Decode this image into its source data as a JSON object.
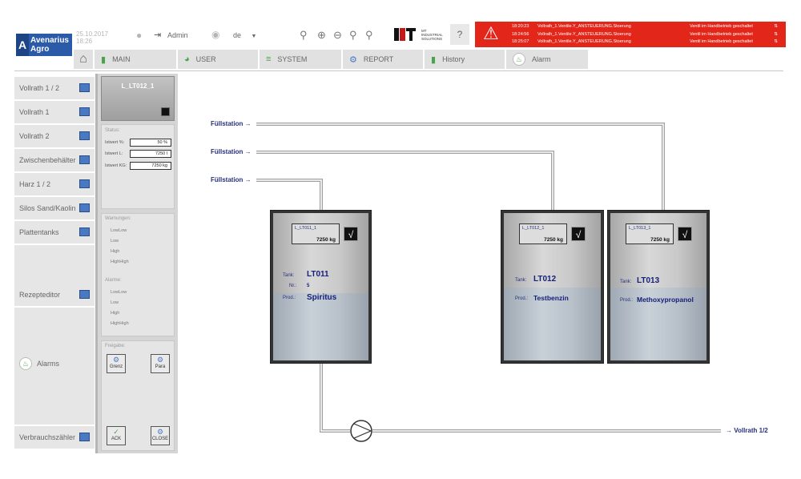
{
  "header": {
    "logo_line1": "Avenarius",
    "logo_line2": "Agro",
    "date": "25.10.2017",
    "time": "18:26",
    "user": "Admin",
    "language": "de",
    "help": "?",
    "brand_mark": "MT",
    "brand_line1": "MT",
    "brand_line2": "INDUSTRIAL",
    "brand_line3": "SOLUTIONS"
  },
  "alarms": [
    {
      "time": "18:20:23",
      "message": "Vollrath_1.Ventile.Y_ANSTEUERUNG.Stoerung",
      "state": "Ventil im Handbetrieb geschaltet"
    },
    {
      "time": "18:24:56",
      "message": "Vollrath_1.Ventile.Y_ANSTEUERUNG.Stoerung",
      "state": "Ventil im Handbetrieb geschaltet"
    },
    {
      "time": "18:25:07",
      "message": "Vollrath_1.Ventile.Y_ANSTEUERUNG.Stoerung",
      "state": "Ventil im Handbetrieb geschaltet"
    }
  ],
  "tabs": [
    {
      "label": "MAIN",
      "icon": "bar-chart-icon"
    },
    {
      "label": "USER",
      "icon": "pie-chart-icon"
    },
    {
      "label": "SYSTEM",
      "icon": "sliders-icon"
    },
    {
      "label": "REPORT",
      "icon": "gears-icon"
    },
    {
      "label": "History",
      "icon": "bar-chart-icon"
    },
    {
      "label": "Alarm",
      "icon": "bell-icon"
    }
  ],
  "nav": [
    "Vollrath 1 / 2",
    "Vollrath 1",
    "Vollrath 2",
    "Zwischenbehälter",
    "Harz 1 / 2",
    "Silos Sand/Kaolin",
    "Plattentanks",
    "Rezepteditor",
    "Alarms",
    "Verbrauchszähler"
  ],
  "panel": {
    "title": "L_LT012_1",
    "status_label": "Status:",
    "istwert_pct_label": "Istwert %:",
    "istwert_pct_value": "50 %",
    "istwert_l_label": "Istwert L:",
    "istwert_l_value": "7250 l",
    "istwert_kg_label": "Istwert KG:",
    "istwert_kg_value": "7250 kg",
    "warnings_label": "Warnungen:",
    "warnings": [
      "LowLow",
      "Low",
      "High",
      "HighHigh"
    ],
    "alarms_label": "Alarme:",
    "alarms": [
      "LowLow",
      "Low",
      "High",
      "HighHigh"
    ],
    "release_label": "Freigabe:",
    "btn_grenz": "Grenz",
    "btn_para": "Para",
    "btn_ack": "ACK",
    "btn_close": "CLOSE"
  },
  "stations": [
    "Füllstation →",
    "Füllstation →",
    "Füllstation →"
  ],
  "tanks": [
    {
      "tag": "L_LT011_1",
      "value": "7250 kg",
      "tank_label": "Tank:",
      "tank": "LT011",
      "nr_label": "Nr.:",
      "nr": "5",
      "prod_label": "Prod.:",
      "product": "Spiritus"
    },
    {
      "tag": "L_LT012_1",
      "value": "7250 kg",
      "tank_label": "Tank:",
      "tank": "LT012",
      "prod_label": "Prod.:",
      "product": "Testbenzin"
    },
    {
      "tag": "L_LT013_1",
      "value": "7250 kg",
      "tank_label": "Tank:",
      "tank": "LT013",
      "prod_label": "Prod.:",
      "product": "Methoxypropanol"
    }
  ],
  "outlet": "→ Vollrath 1/2",
  "colors": {
    "alarm_red": "#e3261a",
    "brand_blue": "#2b5aa8",
    "text_navy": "#27307d"
  }
}
